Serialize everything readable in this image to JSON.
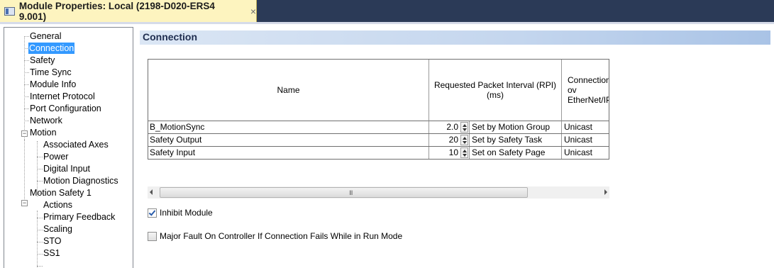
{
  "window": {
    "title": "Module Properties: Local (2198-D020-ERS4 9.001)",
    "close_glyph": "×"
  },
  "tree": {
    "items": [
      {
        "label": "General"
      },
      {
        "label": "Connection"
      },
      {
        "label": "Safety"
      },
      {
        "label": "Time Sync"
      },
      {
        "label": "Module Info"
      },
      {
        "label": "Internet Protocol"
      },
      {
        "label": "Port Configuration"
      },
      {
        "label": "Network"
      },
      {
        "label": "Motion"
      },
      {
        "label": "Associated Axes"
      },
      {
        "label": "Power"
      },
      {
        "label": "Digital Input"
      },
      {
        "label": "Motion Diagnostics"
      },
      {
        "label": "Motion Safety 1"
      },
      {
        "label": "Actions"
      },
      {
        "label": "Primary Feedback"
      },
      {
        "label": "Scaling"
      },
      {
        "label": "STO"
      },
      {
        "label": "SS1"
      }
    ],
    "selected": "Connection",
    "expanded_glyph": "−"
  },
  "section": {
    "title": "Connection"
  },
  "table": {
    "headers": [
      "Name",
      "Requested Packet Interval (RPI) (ms)",
      "Connection over EtherNet/IP"
    ],
    "header_visible": [
      "Name",
      "Requested Packet Interval (RPI)\n(ms)",
      "Connection ov\nEtherNet/IP"
    ],
    "rows": [
      {
        "name": "B_MotionSync",
        "rpi": "2.0",
        "rpi_note": "Set by Motion Group",
        "connection": "Unicast"
      },
      {
        "name": "Safety Output",
        "rpi": "20",
        "rpi_note": "Set by Safety Task",
        "connection": "Unicast"
      },
      {
        "name": "Safety Input",
        "rpi": "10",
        "rpi_note": "Set on Safety Page",
        "connection": "Unicast"
      }
    ]
  },
  "scrollbar": {
    "grip": "III"
  },
  "options": {
    "inhibit_module": {
      "label": "Inhibit Module",
      "checked": true
    },
    "major_fault": {
      "label": "Major Fault On Controller If Connection Fails While in Run Mode",
      "checked": false
    }
  },
  "colors": {
    "titlebar": "#2b3a57",
    "tab": "#fdf4bf",
    "selection": "#3399ff",
    "section_header": "#c4d6ee"
  }
}
